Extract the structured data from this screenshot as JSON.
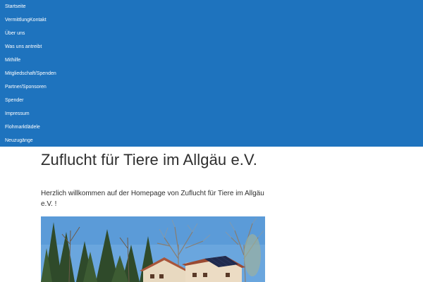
{
  "nav": {
    "items": [
      {
        "label": "Startseite"
      },
      {
        "label": "VermittlungKontakt"
      },
      {
        "label": "Über uns"
      },
      {
        "label": "Was uns antreibt"
      },
      {
        "label": "Mithilfe"
      },
      {
        "label": "Mitgliedschaft/Spenden"
      },
      {
        "label": "Partner/Sponsoren"
      },
      {
        "label": "Spender"
      },
      {
        "label": "Impressum"
      },
      {
        "label": "Flohmarktlädele"
      },
      {
        "label": "Neuzugänge"
      }
    ]
  },
  "main": {
    "title": "Zuflucht für Tiere im Allgäu e.V.",
    "welcome": "Herzlich willkommen auf der Homepage von Zuflucht für Tiere im Allgäu e.V. !"
  },
  "colors": {
    "nav_background": "#1e73be",
    "nav_text": "#ffffff"
  }
}
